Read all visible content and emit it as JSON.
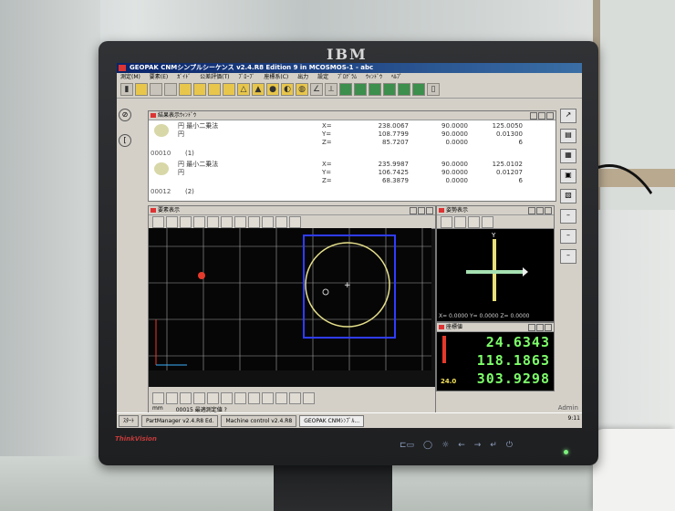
{
  "monitor": {
    "brand": "IBM",
    "model": "ThinkVision"
  },
  "app": {
    "title": "GEOPAK CNMシンプルシーケンス v2.4.R8 Edition 9 in MCOSMOS-1 - abc",
    "menu": [
      "測定(M)",
      "要素(E)",
      "ｶﾞｲﾄﾞ",
      "公差評価(T)",
      "ﾌﾟﾛｰﾌﾞ",
      "座標系(C)",
      "出力",
      "設定",
      "ﾌﾟﾛｸﾞﾗﾑ",
      "ｳｨﾝﾄﾞｳ",
      "ﾍﾙﾌﾟ"
    ]
  },
  "results_panel": {
    "title": "結果表示ｳｨﾝﾄﾞｳ",
    "rows": [
      {
        "type": "円 最小二乗法",
        "name": "円",
        "number": "00010",
        "sub": "(1)",
        "xyz": [
          "238.0067",
          "108.7799",
          "85.7207"
        ],
        "abc": [
          "90.0000",
          "90.0000",
          "0.0000"
        ],
        "vals": [
          "125.0050",
          "0.01300",
          "6"
        ]
      },
      {
        "type": "円 最小二乗法",
        "name": "円",
        "number": "00012",
        "sub": "(2)",
        "xyz": [
          "235.9987",
          "106.7425",
          "68.3879"
        ],
        "abc": [
          "90.0000",
          "90.0000",
          "0.0000"
        ],
        "vals": [
          "125.0102",
          "0.01207",
          "6"
        ]
      }
    ]
  },
  "graphics_panel": {
    "title": "要素表示"
  },
  "axes_panel": {
    "title": "姿勢表示",
    "readout": "X= 0.0000  Y= 0.0000  Z= 0.0000"
  },
  "dro_panel": {
    "title": "座標値",
    "x": "24.6343",
    "y": "118.1863",
    "z": "303.9298",
    "probe_label": "24.0"
  },
  "statusbar": {
    "unit": "mm",
    "status": "00015 最適測定値 ?",
    "admin": "Admin"
  },
  "taskbar": {
    "start": "ｽﾀｰﾄ",
    "tasks": [
      "PartManager v2.4.R8 Ed.",
      "Machine control v2.4.R8",
      "GEOPAK CNMｼﾝﾌﾟﾙ..."
    ],
    "clock": "9:11"
  }
}
